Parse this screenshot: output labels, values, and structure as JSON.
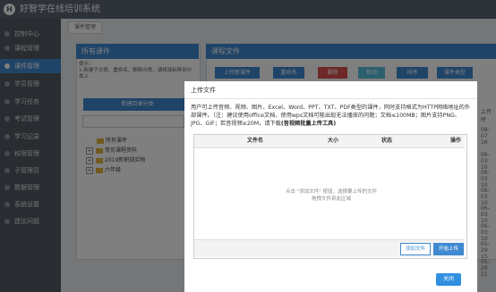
{
  "app": {
    "logo_letter": "H",
    "title": "好智学在线培训系统"
  },
  "sidebar": {
    "items": [
      {
        "label": "控制中心",
        "active": false
      },
      {
        "label": "课程管理",
        "active": false
      },
      {
        "label": "课件管理",
        "active": true
      },
      {
        "label": "学员管理",
        "active": false
      },
      {
        "label": "学习任务",
        "active": false
      },
      {
        "label": "考试管理",
        "active": false
      },
      {
        "label": "学习记录",
        "active": false
      },
      {
        "label": "权限管理",
        "active": false
      },
      {
        "label": "子管理员",
        "active": false
      },
      {
        "label": "数据管理",
        "active": false
      },
      {
        "label": "系统设置",
        "active": false
      },
      {
        "label": "建议问题",
        "active": false
      }
    ]
  },
  "tab": {
    "label": "课件管理"
  },
  "left_panel": {
    "header": "所有课件",
    "hint_title": "提示：",
    "hint_body": "1.新建子分类、重命名、删除分类，请将鼠标移到分类上",
    "new_category_button": "新建目录分类",
    "tree": [
      {
        "label": "所有课件",
        "expander": ""
      },
      {
        "label": "常见课程资料",
        "expander": "+"
      },
      {
        "label": "2019新职规实物",
        "expander": "+"
      },
      {
        "label": "六年级",
        "expander": "+"
      }
    ]
  },
  "right_panel": {
    "header": "课程文件",
    "toolbar": {
      "upload": "上传新课件",
      "rename": "重命名",
      "delete": "删除",
      "move": "移动",
      "sort": "排序",
      "courseware_type": "课件类型"
    },
    "dates": [
      "上传时",
      "08-07 16",
      "06-03 10",
      "06-03 10",
      "06-03 10",
      "06-03 10",
      "06-03 10",
      "05-29 15",
      "05-29 11"
    ]
  },
  "modal": {
    "title": "上传文件",
    "description": "用户可上传音频、视频、图片、Excel、Word、PPT、TXT、PDF类型的课件，同时支持格式为HTTP网络地址的外部课件。（注：建议使用office文档，使用wps文档可能出现无法播放的问题；文档≤100MB；图片支持PNG、JPG、GIF；若音视频≥20M，请下载",
    "description_bold": "(音视频批量上传工具)",
    "table": {
      "columns": [
        "文件名",
        "大小",
        "状态",
        "操作"
      ],
      "empty_line1": "点击 \"添加文件\" 按钮，选择要上传的文件",
      "empty_line2": "拖拽文件到此区域"
    },
    "add_file_button": "添加文件",
    "start_upload_button": "开始上传",
    "close_button": "关闭"
  },
  "colors": {
    "accent": "#3f89d1",
    "topbar": "#5a6470",
    "sidebar": "#525b65"
  }
}
